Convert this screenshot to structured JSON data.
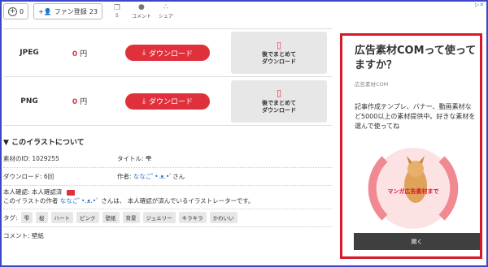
{
  "topbar": {
    "follow_count": "0",
    "fan_label": "ファン登録",
    "fan_count": "23",
    "stat_count": "5",
    "comment_label": "コメント",
    "share_label": "シェア"
  },
  "downloads": [
    {
      "format": "JPEG",
      "price": "0",
      "currency": "円",
      "download_label": "ダウンロード",
      "later_line1": "後でまとめて",
      "later_line2": "ダウンロード"
    },
    {
      "format": "PNG",
      "price": "0",
      "currency": "円",
      "download_label": "ダウンロード",
      "later_line1": "後でまとめて",
      "later_line2": "ダウンロード"
    }
  ],
  "about": {
    "heading": "このイラストについて",
    "material_id": "素材のID: 1029255",
    "title": "タイトル: 雫",
    "downloads": "ダウンロード: 6回",
    "author_label": "作者: ",
    "author_name": "ななごﾟ•.ᴥ.•ﾟ",
    "author_suffix": "さん",
    "verify_line": "本人確認: 本人確認済",
    "verify_prefix": "このイラストの作者",
    "verify_name": "ななごﾟ•.ᴥ.•ﾟ",
    "verify_suffix": "さんは、 本人確認が済んでいるイラストレーターです。",
    "tags_label": "タグ:",
    "tags": [
      "雫",
      "桜",
      "ハート",
      "ピンク",
      "壁紙",
      "背景",
      "ジュエリー",
      "キラキラ",
      "かわいい"
    ],
    "comment": "コメント: 壁紙"
  },
  "ad": {
    "title": "広告素材COMって使ってますか？",
    "sub": "広告素材COM",
    "body": "記事作成テンプレ、バナー、動画素材など5000以上の素材提供中。好きな素材を選んで使ってね",
    "art_text": "マンガ広告素材まで",
    "button": "開く",
    "accent": "#d8192a"
  }
}
